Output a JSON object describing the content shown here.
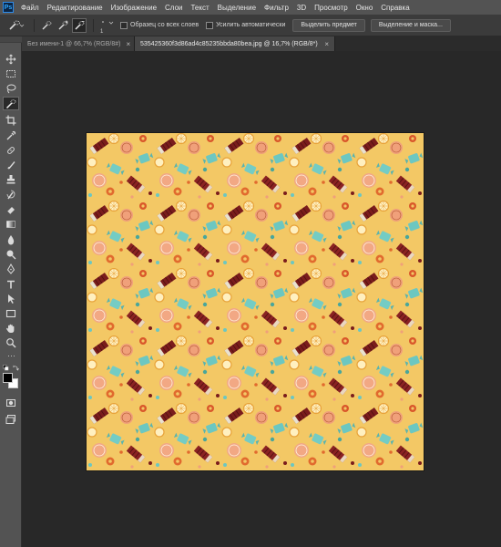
{
  "menu": {
    "app_logo": "Ps",
    "items": [
      "Файл",
      "Редактирование",
      "Изображение",
      "Слои",
      "Текст",
      "Выделение",
      "Фильтр",
      "3D",
      "Просмотр",
      "Окно",
      "Справка"
    ]
  },
  "options": {
    "brush_size": "1",
    "sample_all_layers": "Образец со всех слоев",
    "auto_enhance": "Усилить автоматически",
    "select_subject": "Выделить предмет",
    "select_and_mask": "Выделение и маска..."
  },
  "tabs": [
    {
      "label": "Без имени-1 @ 66,7% (RGB/8#)",
      "close": "×",
      "active": false
    },
    {
      "label": "535425360f3d86ad4c85235bbda80bea.jpg @ 16,7% (RGB/8*)",
      "close": "×",
      "active": true
    }
  ],
  "tools": [
    "move-tool",
    "marquee-tool",
    "lasso-tool",
    "quick-selection-tool",
    "crop-tool",
    "eyedropper-tool",
    "healing-brush-tool",
    "brush-tool",
    "clone-stamp-tool",
    "history-brush-tool",
    "eraser-tool",
    "gradient-tool",
    "blur-tool",
    "dodge-tool",
    "pen-tool",
    "type-tool",
    "path-selection-tool",
    "rectangle-tool",
    "hand-tool",
    "zoom-tool"
  ],
  "colors": {
    "foreground": "#000000",
    "background": "#ffffff",
    "pattern_background": "#f3c865"
  }
}
